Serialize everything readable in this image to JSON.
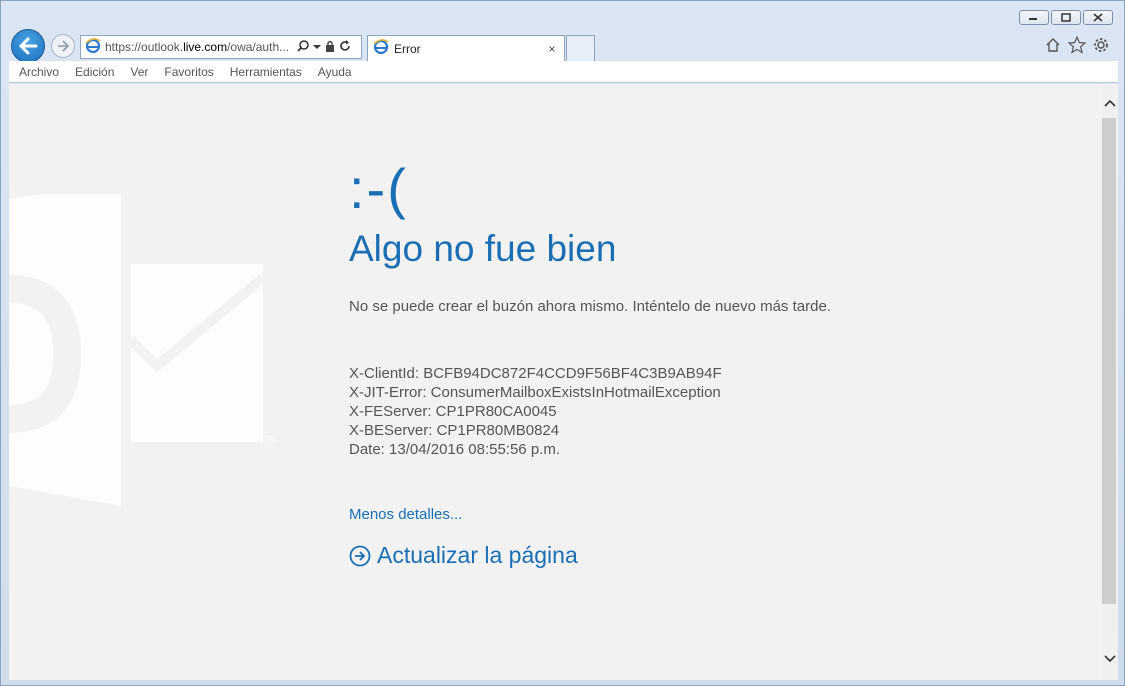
{
  "browser": {
    "address": {
      "scheme": "https://",
      "host_prefix": "outlook.",
      "host": "live.com",
      "path": "/owa/auth..."
    },
    "tab": {
      "title": "Error",
      "close": "×"
    },
    "menu": [
      "Archivo",
      "Edición",
      "Ver",
      "Favoritos",
      "Herramientas",
      "Ayuda"
    ]
  },
  "page": {
    "emoticon": ":-(",
    "heading": "Algo no fue bien",
    "message": "No se puede crear el buzón ahora mismo. Inténtelo de nuevo más tarde.",
    "details": [
      "X-ClientId: BCFB94DC872F4CCD9F56BF4C3B9AB94F",
      "X-JIT-Error: ConsumerMailboxExistsInHotmailException",
      "X-FEServer: CP1PR80CA0045",
      "X-BEServer: CP1PR80MB0824",
      "Date: 13/04/2016 08:55:56 p.m."
    ],
    "less_details": "Menos detalles...",
    "refresh": "Actualizar la página"
  },
  "colors": {
    "accent": "#1a6fb4",
    "text": "#555555",
    "background": "#f2f2f2"
  }
}
